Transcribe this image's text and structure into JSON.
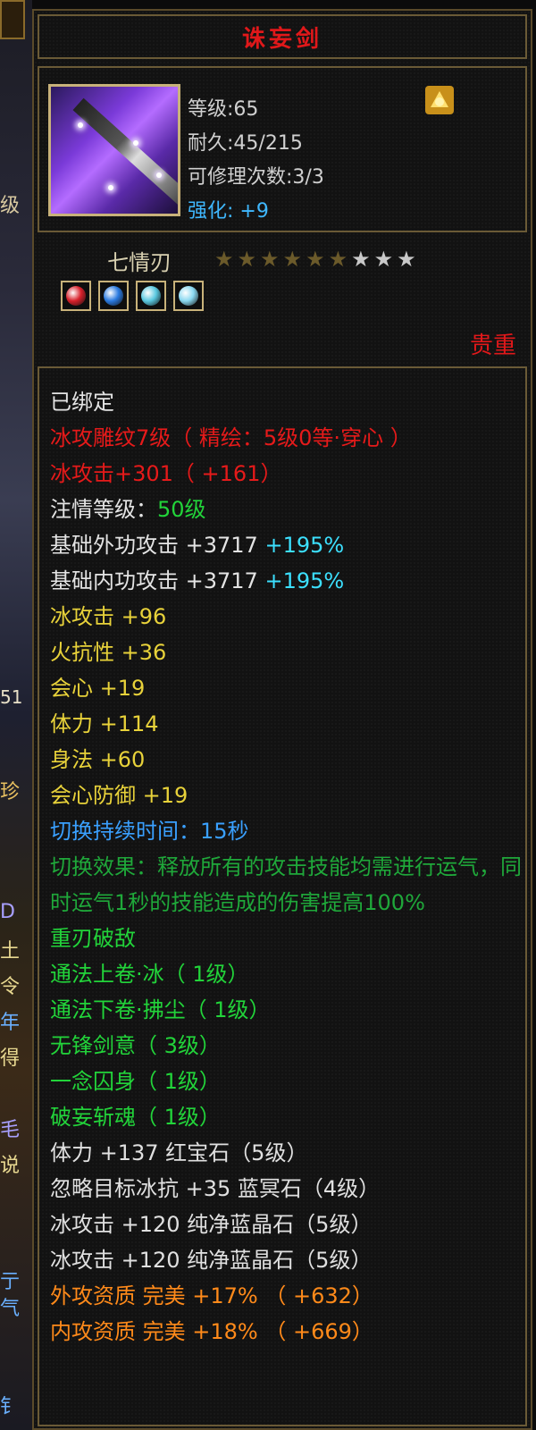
{
  "scene": {
    "fragments": [
      "级",
      "51",
      "珍",
      "D",
      "土",
      "令",
      "年",
      "得",
      "毛",
      "说",
      "亍",
      "气",
      "钅"
    ]
  },
  "item": {
    "name": "诛妄剑",
    "level": "等级:65",
    "durability": "耐久:45/215",
    "repairs": "可修理次数:3/3",
    "enhance_label": "强化:",
    "enhance_value": "+9",
    "set_name": "七情刃",
    "stars_filled": 6,
    "stars_total": 9,
    "rarity": "贵重",
    "gems": [
      {
        "name": "red-gem",
        "color": "#d8202a"
      },
      {
        "name": "blue-gem",
        "color": "#2a7ae0"
      },
      {
        "name": "cyan-gem",
        "color": "#5ac8e0"
      },
      {
        "name": "lightblue-gem",
        "color": "#8ad8f0"
      }
    ]
  },
  "attributes": {
    "bound": "已绑定",
    "engrave": "冰攻雕纹7级（ 精绘：5级0等·穿心 ）",
    "ice_attack_main": "冰攻击+301（ +161）",
    "infuse_label": "注情等级：",
    "infuse_value": "50级",
    "ext_attack_label": "基础外功攻击 +3717 ",
    "ext_attack_pct": "+195%",
    "int_attack_label": "基础内功攻击 +3717 ",
    "int_attack_pct": "+195%",
    "ice_attack": "冰攻击 +96",
    "fire_resist": "火抗性 +36",
    "crit": "会心 +19",
    "stamina": "体力 +114",
    "agility": "身法 +60",
    "crit_def": "会心防御 +19",
    "switch_duration": "切换持续时间：15秒",
    "switch_effect": "切换效果：释放所有的攻击技能均需进行运气，同时运气1秒的技能造成的伤害提高100%",
    "skill_1": "重刃破敌",
    "skill_2": "通法上卷·冰（ 1级）",
    "skill_3": "通法下卷·拂尘（ 1级）",
    "skill_4": "无锋剑意（ 3级）",
    "skill_5": "一念囚身（ 1级）",
    "skill_6": "破妄斩魂（ 1级）",
    "gem_1": "体力 +137 红宝石（5级）",
    "gem_2": "忽略目标冰抗 +35 蓝冥石（4级）",
    "gem_3": "冰攻击 +120 纯净蓝晶石（5级）",
    "gem_4": "冰攻击 +120 纯净蓝晶石（5级）",
    "quality_ext": "外攻资质  完美 +17% （ +632）",
    "quality_int": "内攻资质  完美 +18% （ +669）"
  },
  "colors": {
    "title": "#e0181a",
    "border": "#6a5a36",
    "star_filled": "#6b5a2a",
    "star_empty": "#c8c8c8"
  }
}
